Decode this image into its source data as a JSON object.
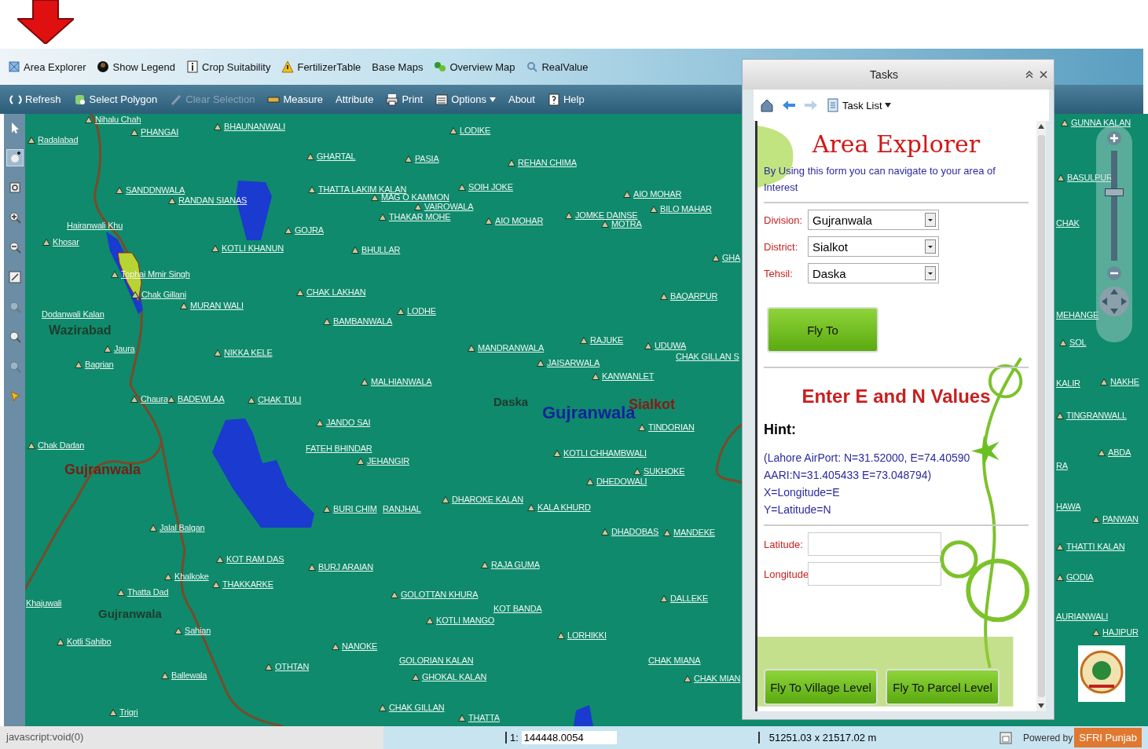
{
  "toolbar": [
    {
      "label": "Area Explorer"
    },
    {
      "label": "Show Legend"
    },
    {
      "label": "Crop Suitability"
    },
    {
      "label": "FertilizerTable"
    },
    {
      "label": "Base Maps"
    },
    {
      "label": "Overview Map"
    },
    {
      "label": "RealValue"
    }
  ],
  "map_toolbar": [
    {
      "label": "Refresh",
      "disabled": false,
      "dropdown": false
    },
    {
      "label": "Select Polygon",
      "disabled": false,
      "dropdown": false
    },
    {
      "label": "Clear Selection",
      "disabled": true,
      "dropdown": false
    },
    {
      "label": "Measure",
      "disabled": false,
      "dropdown": false
    },
    {
      "label": "Attribute",
      "disabled": false,
      "dropdown": false
    },
    {
      "label": "Print",
      "disabled": false,
      "dropdown": false
    },
    {
      "label": "Options",
      "disabled": false,
      "dropdown": true
    },
    {
      "label": "About",
      "disabled": false,
      "dropdown": false
    },
    {
      "label": "Help",
      "disabled": false,
      "dropdown": false
    }
  ],
  "map_tools": [
    {
      "selected": false,
      "disabled": false
    },
    {
      "selected": true,
      "disabled": false
    },
    {
      "selected": false,
      "disabled": false
    },
    {
      "selected": false,
      "disabled": false
    },
    {
      "selected": false,
      "disabled": false
    },
    {
      "selected": false,
      "disabled": false
    },
    {
      "selected": false,
      "disabled": true
    },
    {
      "selected": false,
      "disabled": false
    },
    {
      "selected": false,
      "disabled": true
    },
    {
      "selected": false,
      "disabled": false
    }
  ],
  "places": [
    {
      "name": "Nihalu Chah",
      "kind": "village"
    },
    {
      "name": "Radalabad",
      "kind": "village"
    },
    {
      "name": "PHANGAI",
      "kind": "village"
    },
    {
      "name": "BHAUNANWALI",
      "kind": "village"
    },
    {
      "name": "LODIKE",
      "kind": "village"
    },
    {
      "name": "GHARTAL",
      "kind": "village"
    },
    {
      "name": "PASIA",
      "kind": "village"
    },
    {
      "name": "REHAN CHIMA",
      "kind": "village"
    },
    {
      "name": "SANDDNWALA",
      "kind": "village"
    },
    {
      "name": "RANDAN SIANAS",
      "kind": "village"
    },
    {
      "name": "THATTA LAKIM KALAN",
      "kind": "village"
    },
    {
      "name": "MAG O KAMMON",
      "kind": "village"
    },
    {
      "name": "SOIH JOKE",
      "kind": "village"
    },
    {
      "name": "VAIROWALA",
      "kind": "village"
    },
    {
      "name": "THAKAR MOHE",
      "kind": "village"
    },
    {
      "name": "AIO MOHAR",
      "kind": "village"
    },
    {
      "name": "AIO MOHAR",
      "kind": "village"
    },
    {
      "name": "JOMKE DAINSE",
      "kind": "village"
    },
    {
      "name": "MOTRA",
      "kind": "village"
    },
    {
      "name": "BILO MAHAR",
      "kind": "village"
    },
    {
      "name": "Hairanwali Khu",
      "kind": "label"
    },
    {
      "name": "Khosar",
      "kind": "village"
    },
    {
      "name": "GOJRA",
      "kind": "village"
    },
    {
      "name": "KOTLI KHANUN",
      "kind": "village"
    },
    {
      "name": "BHULLAR",
      "kind": "village"
    },
    {
      "name": "GHA",
      "kind": "village"
    },
    {
      "name": "Tophai Mmir Singh",
      "kind": "village"
    },
    {
      "name": "Chak Gillani",
      "kind": "village"
    },
    {
      "name": "MURAN WALI",
      "kind": "village"
    },
    {
      "name": "CHAK LAKHAN",
      "kind": "village"
    },
    {
      "name": "BAQARPUR",
      "kind": "village"
    },
    {
      "name": "Dodanwali Kalan",
      "kind": "label"
    },
    {
      "name": "LODHE",
      "kind": "village"
    },
    {
      "name": "BAMBANWALA",
      "kind": "village"
    },
    {
      "name": "Jaura",
      "kind": "village"
    },
    {
      "name": "Bagrian",
      "kind": "village"
    },
    {
      "name": "NIKKA KELE",
      "kind": "village"
    },
    {
      "name": "MANDRANWALA",
      "kind": "village"
    },
    {
      "name": "RAJUKE",
      "kind": "village"
    },
    {
      "name": "UDUWA",
      "kind": "village"
    },
    {
      "name": "CHAK GILLAN S",
      "kind": "label"
    },
    {
      "name": "JAISARWALA",
      "kind": "village"
    },
    {
      "name": "KANWANLET",
      "kind": "village"
    },
    {
      "name": "MALHIANWALA",
      "kind": "village"
    },
    {
      "name": "Chaura",
      "kind": "village"
    },
    {
      "name": "BADEWLAA",
      "kind": "village"
    },
    {
      "name": "CHAK TULI",
      "kind": "village"
    },
    {
      "name": "JANDO SAI",
      "kind": "village"
    },
    {
      "name": "TINDORIAN",
      "kind": "village"
    },
    {
      "name": "Chak Dadan",
      "kind": "village"
    },
    {
      "name": "FATEH BHINDAR",
      "kind": "label"
    },
    {
      "name": "JEHANGIR",
      "kind": "village"
    },
    {
      "name": "KOTLI CHHAMBWALI",
      "kind": "village"
    },
    {
      "name": "SUKHOKE",
      "kind": "village"
    },
    {
      "name": "DHEDOWALI",
      "kind": "village"
    },
    {
      "name": "BURI CHIM",
      "kind": "village"
    },
    {
      "name": "RANJHAL",
      "kind": "label"
    },
    {
      "name": "DHAROKE KALAN",
      "kind": "village"
    },
    {
      "name": "KALA KHURD",
      "kind": "village"
    },
    {
      "name": "Jalal Balgan",
      "kind": "village"
    },
    {
      "name": "DHADOBAS",
      "kind": "village"
    },
    {
      "name": "MANDEKE",
      "kind": "village"
    },
    {
      "name": "KOT RAM DAS",
      "kind": "village"
    },
    {
      "name": "BURJ ARAIAN",
      "kind": "village"
    },
    {
      "name": "RAJA GUMA",
      "kind": "village"
    },
    {
      "name": "Khalkoke",
      "kind": "village"
    },
    {
      "name": "THAKKARKE",
      "kind": "village"
    },
    {
      "name": "Thatta Dad",
      "kind": "village"
    },
    {
      "name": "GOLOTTAN KHURA",
      "kind": "village"
    },
    {
      "name": "DALLEKE",
      "kind": "village"
    },
    {
      "name": "Khajuwali",
      "kind": "label"
    },
    {
      "name": "KOT BANDA",
      "kind": "label"
    },
    {
      "name": "KOTLI MANGO",
      "kind": "village"
    },
    {
      "name": "Sahian",
      "kind": "village"
    },
    {
      "name": "LORHIKKI",
      "kind": "village"
    },
    {
      "name": "Kotli Sahibo",
      "kind": "village"
    },
    {
      "name": "NANOKE",
      "kind": "village"
    },
    {
      "name": "OTHTAN",
      "kind": "village"
    },
    {
      "name": "GOLORIAN KALAN",
      "kind": "label"
    },
    {
      "name": "GHOKAL KALAN",
      "kind": "village"
    },
    {
      "name": "CHAK MIANA",
      "kind": "label"
    },
    {
      "name": "CHAK MIAN",
      "kind": "village"
    },
    {
      "name": "Ballewala",
      "kind": "village"
    },
    {
      "name": "CHAK GILLAN",
      "kind": "village"
    },
    {
      "name": "THATTA",
      "kind": "village"
    },
    {
      "name": "Trigri",
      "kind": "village"
    },
    {
      "name": "GUNNA KALAN",
      "kind": "village"
    },
    {
      "name": "BASULPUR",
      "kind": "village"
    },
    {
      "name": "CHAK",
      "kind": "label"
    },
    {
      "name": "MEHANGE",
      "kind": "label"
    },
    {
      "name": "SOL",
      "kind": "village"
    },
    {
      "name": "KALIR",
      "kind": "label"
    },
    {
      "name": "NAKHE",
      "kind": "village"
    },
    {
      "name": "TINGRANWALL",
      "kind": "village"
    },
    {
      "name": "RA",
      "kind": "label"
    },
    {
      "name": "ABDA",
      "kind": "village"
    },
    {
      "name": "HAWA",
      "kind": "label"
    },
    {
      "name": "PANWAN",
      "kind": "village"
    },
    {
      "name": "THATTI KALAN",
      "kind": "village"
    },
    {
      "name": "GODIA",
      "kind": "village"
    },
    {
      "name": "AURIANWALI",
      "kind": "label"
    },
    {
      "name": "HAJIPUR",
      "kind": "village"
    }
  ],
  "regions": [
    {
      "name": "Wazirabad",
      "color": "#1d3b2c"
    },
    {
      "name": "Daska",
      "color": "#1d3b2c"
    },
    {
      "name": "Gujranwala",
      "color": "#12239a"
    },
    {
      "name": "Sialkot",
      "color": "#8a1a14"
    },
    {
      "name": "Gujranwala",
      "color": "#7a1c12"
    },
    {
      "name": "Gujranwala",
      "color": "#1d3b2c"
    }
  ],
  "zoom_slider": {
    "level": 0.62
  },
  "tasks": {
    "title": "Tasks",
    "task_list": "Task List",
    "heading": "Area Explorer",
    "intro": "By Using this form you can navigate to your area of Interest",
    "fields": [
      {
        "label": "Division:",
        "value": "Gujranwala"
      },
      {
        "label": "District:",
        "value": "Sialkot"
      },
      {
        "label": "Tehsil:",
        "value": "Daska"
      }
    ],
    "fly_button": "Fly To",
    "coords_heading": "Enter E and N Values",
    "hint_title": "Hint:",
    "hint_lines": [
      "(Lahore AirPort: N=31.52000, E=74.40590",
      "AARI:N=31.405433 E=73.048794)",
      "X=Longitude=E",
      "Y=Latitude=N"
    ],
    "inputs": [
      {
        "label": "Latitude:"
      },
      {
        "label": "Longitude"
      }
    ],
    "buttons": [
      "Fly To Village Level",
      "Fly To Parcel Level"
    ]
  },
  "status_bar": {
    "link": "javascript:void(0)",
    "scale_prefix": "1:",
    "scale": "144448.0054",
    "extent": "51251.03 x 21517.02 m",
    "powered_by": "Powered by",
    "brand": "SFRI Punjab"
  }
}
